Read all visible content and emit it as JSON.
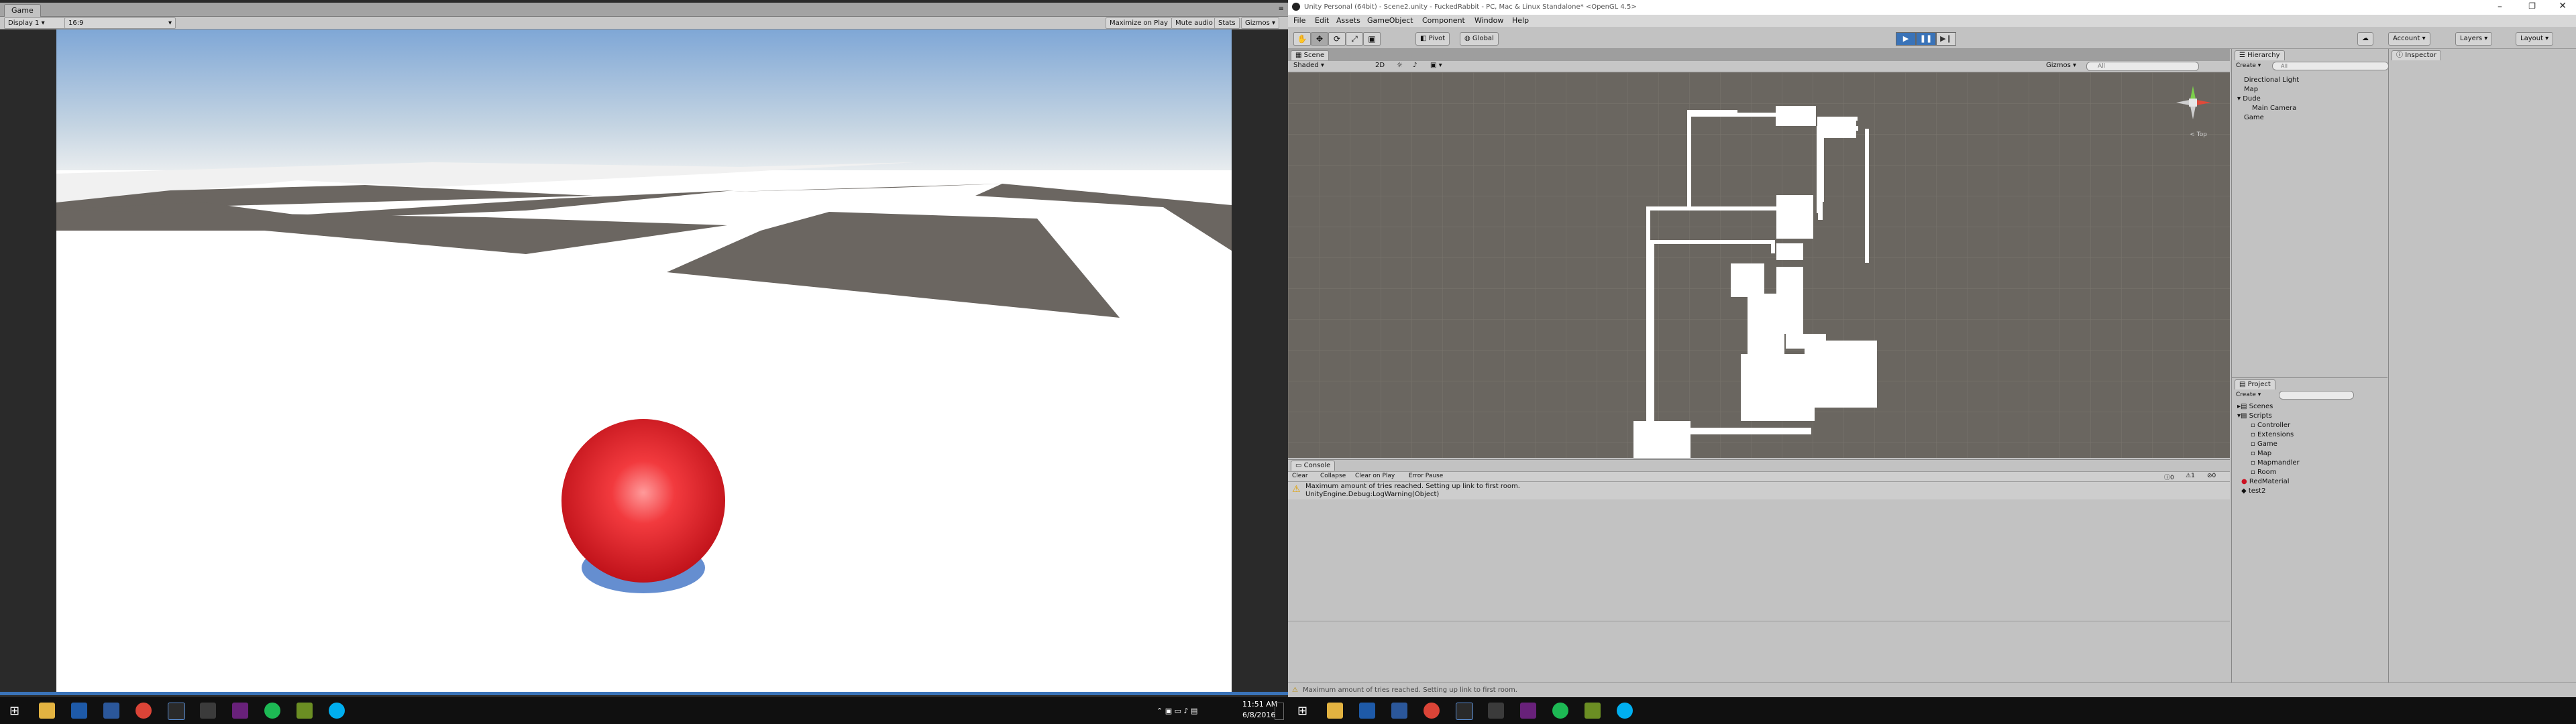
{
  "game": {
    "tab_label": "Game",
    "display_label": "Display 1",
    "aspect_label": "16:9",
    "maximize_label": "Maximize on Play",
    "mute_label": "Mute audio",
    "stats_label": "Stats",
    "gizmos_label": "Gizmos"
  },
  "editor": {
    "title": "Unity Personal (64bit) - Scene2.unity - FuckedRabbit - PC, Mac & Linux Standalone* <OpenGL 4.5>",
    "menus": [
      "File",
      "Edit",
      "Assets",
      "GameObject",
      "Component",
      "Window",
      "Help"
    ],
    "toolbar": {
      "pivot_label": "Pivot",
      "global_label": "Global",
      "account_label": "Account",
      "layers_label": "Layers",
      "layout_label": "Layout"
    },
    "scene": {
      "tab_label": "Scene",
      "shading_label": "Shaded",
      "mode_2d": "2D",
      "gizmos_label": "Gizmos",
      "search_placeholder": "All",
      "view_label": "< Top"
    },
    "hierarchy": {
      "tab_label": "Hierarchy",
      "create_label": "Create",
      "search_placeholder": "All",
      "items": [
        "Directional Light",
        "Map",
        "Dude",
        "Main Camera",
        "Game"
      ]
    },
    "project": {
      "tab_label": "Project",
      "create_label": "Create",
      "items": [
        "Scenes",
        "Scripts",
        "Controller",
        "Extensions",
        "Game",
        "Map",
        "Mapmandler",
        "Room",
        "RedMaterial",
        "test2"
      ]
    },
    "inspector": {
      "tab_label": "Inspector"
    },
    "console": {
      "tab_label": "Console",
      "buttons": [
        "Clear",
        "Collapse",
        "Clear on Play",
        "Error Pause"
      ],
      "counts": [
        "0",
        "1",
        "0"
      ],
      "message_line1": "Maximum amount of tries reached. Setting up link to first room.",
      "message_line2": "UnityEngine.Debug:LogWarning(Object)"
    },
    "status_message": "Maximum amount of tries reached. Setting up link to first room."
  },
  "taskbar": {
    "time": "11:51 AM",
    "date": "6/8/2016"
  },
  "colors": {
    "sphere": "#e8242a",
    "accent_blue": "#3a73b8",
    "scene_bg": "#6a6660",
    "taskbar": "#101010"
  }
}
